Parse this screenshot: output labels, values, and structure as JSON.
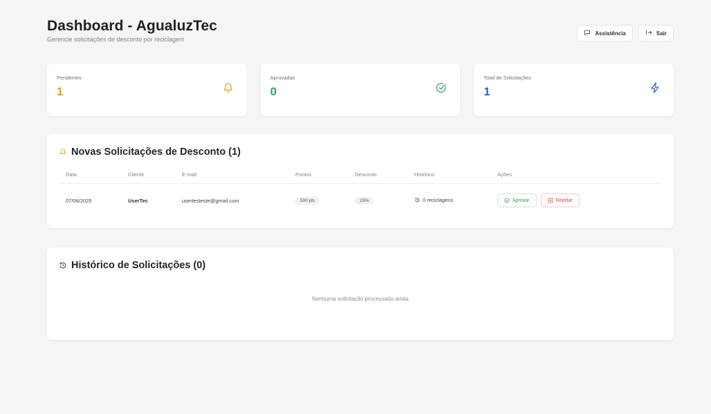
{
  "header": {
    "title": "Dashboard - AgualuzTec",
    "subtitle": "Gerencie solicitações de desconto por reciclagem",
    "assist_label": "Assistência",
    "logout_label": "Sair"
  },
  "stats": [
    {
      "label": "Pendentes",
      "value": "1",
      "color": "#d9a219",
      "icon": "bell-icon"
    },
    {
      "label": "Aprovadas",
      "value": "0",
      "color": "#2ea35a",
      "icon": "check-circle-icon"
    },
    {
      "label": "Total de Solicitações",
      "value": "1",
      "color": "#2f63c7",
      "icon": "lightning-icon"
    }
  ],
  "requests": {
    "title": "Novas Solicitações de Desconto (1)",
    "columns": [
      "Data",
      "Cliente",
      "E-mail",
      "Pontos",
      "Desconto",
      "Histórico",
      "Ações"
    ],
    "rows": [
      {
        "date": "07/06/2025",
        "client": "UserTec",
        "email": "usertesteste@gmail.com",
        "points": "500 pts",
        "discount": "15%",
        "history": "0 reciclagens",
        "approve": "Aprovar",
        "reject": "Rejeitar"
      }
    ]
  },
  "history": {
    "title": "Histórico de Solicitações (0)",
    "empty": "Nenhuma solicitação processada ainda"
  }
}
